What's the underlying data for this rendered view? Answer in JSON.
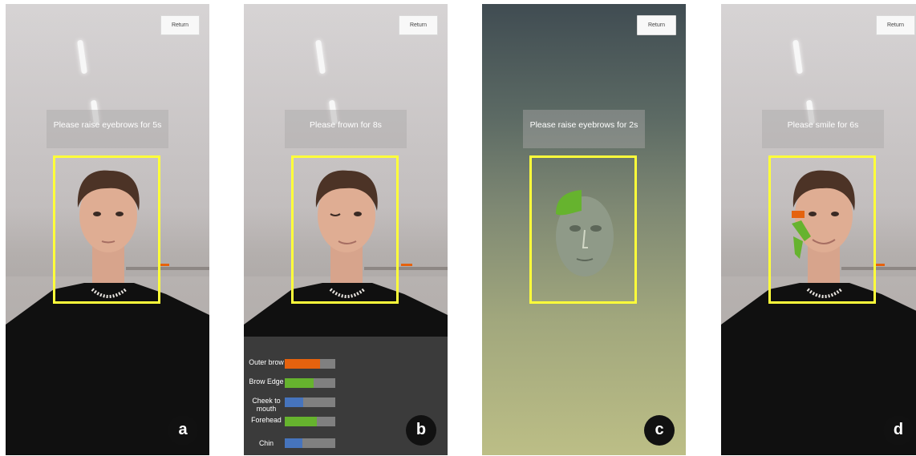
{
  "panels": [
    {
      "id": "a",
      "return_label": "Return",
      "prompt": "Please raise eyebrows for 5s"
    },
    {
      "id": "b",
      "return_label": "",
      "prompt": "Please frown for 8s"
    },
    {
      "id": "c",
      "return_label": "Return",
      "prompt": "Please raise eyebrows for 2s"
    },
    {
      "id": "d",
      "return_label": "Return",
      "prompt": "Please smile for 6s"
    }
  ],
  "panel_b_return": "Return",
  "metrics": [
    {
      "label": "Outer brow",
      "fraction": 0.7,
      "color": "#e5620e"
    },
    {
      "label": "Brow Edge",
      "fraction": 0.57,
      "color": "#66b32e"
    },
    {
      "label": "Cheek to mouth",
      "fraction": 0.37,
      "color": "#4674bd"
    },
    {
      "label": "Forehead",
      "fraction": 0.63,
      "color": "#66b32e"
    },
    {
      "label": "Chin",
      "fraction": 0.35,
      "color": "#4674bd"
    }
  ],
  "colors": {
    "face_box": "#ffff3a",
    "badge": "#111111",
    "overlay_green": "#66b32e",
    "overlay_orange": "#e5620e"
  }
}
